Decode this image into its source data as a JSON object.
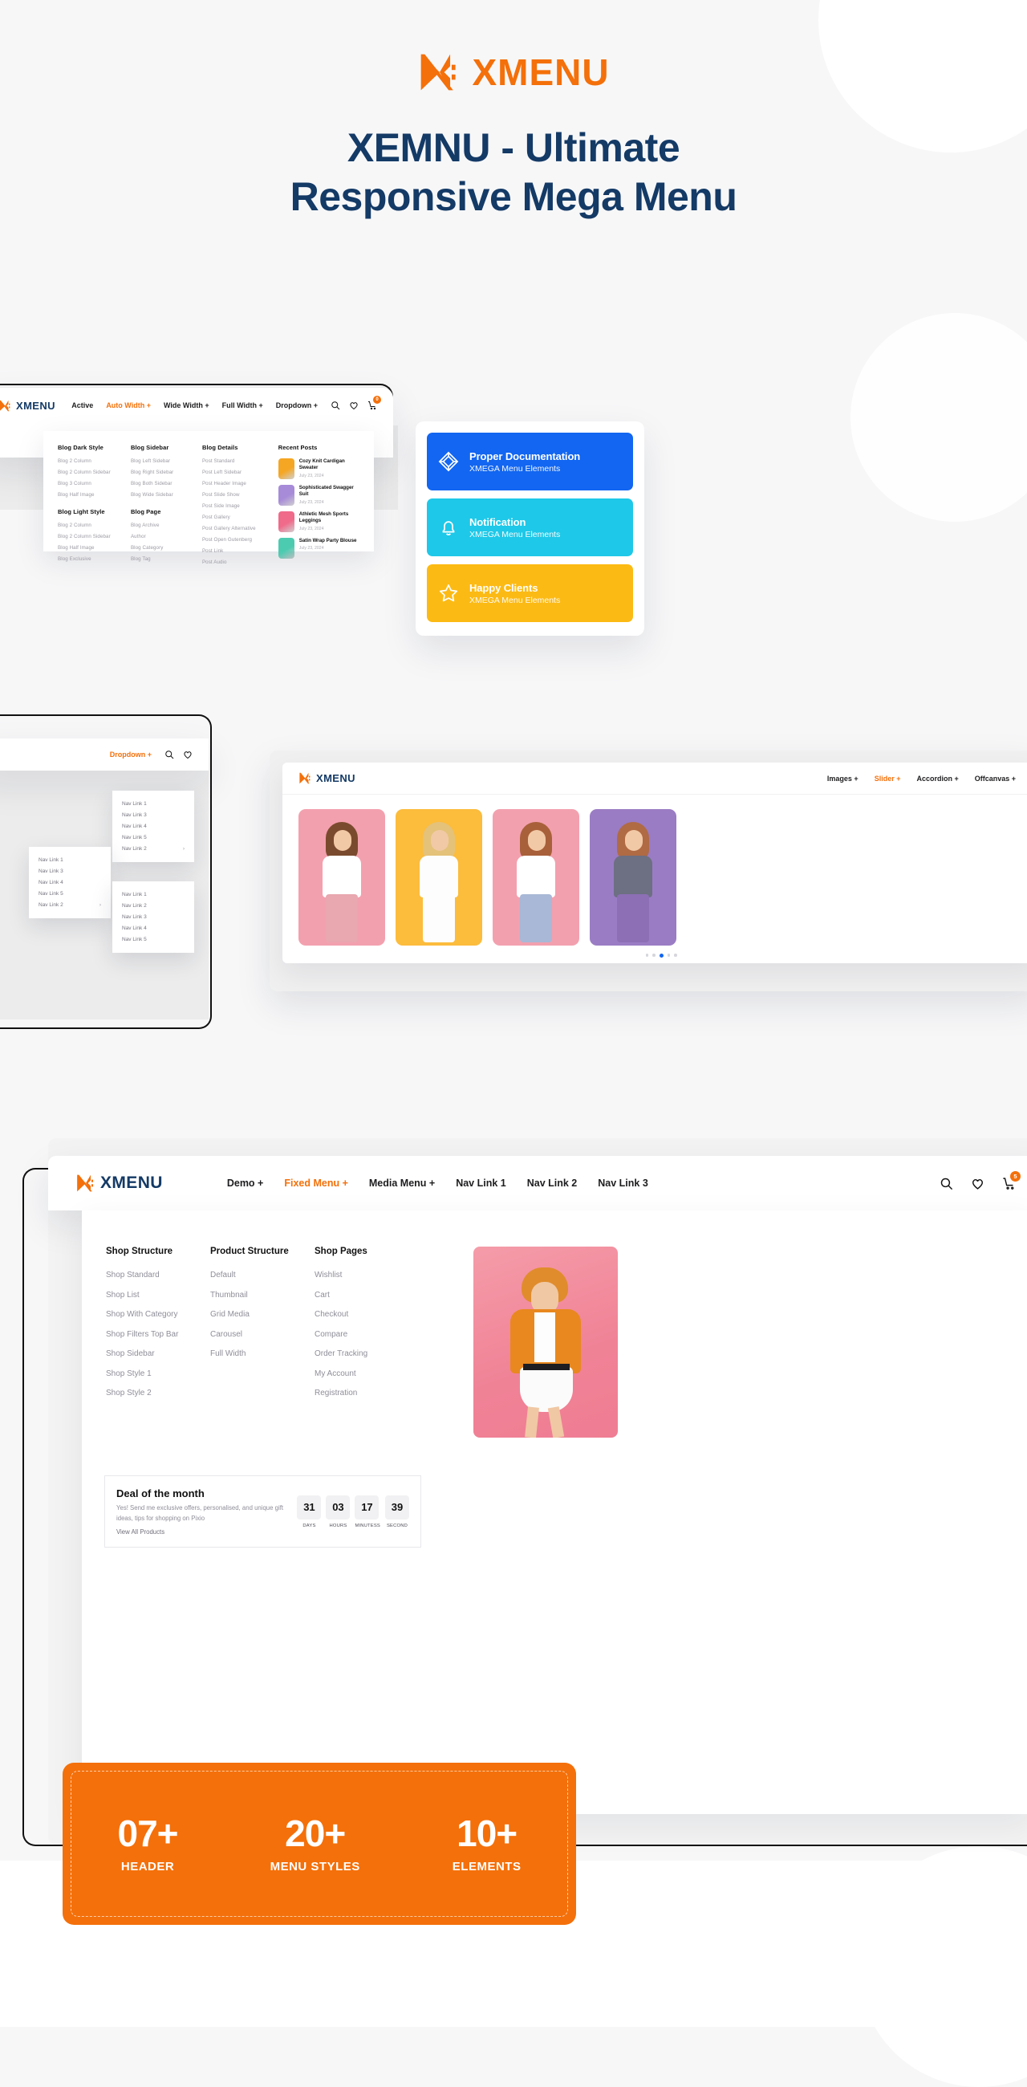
{
  "hero": {
    "logo_word": "XMENU",
    "title_line1": "XEMNU - Ultimate",
    "title_line2": "Responsive Mega Menu"
  },
  "blog_panel": {
    "brand": "XMENU",
    "nav": [
      {
        "label": "Active",
        "active": false,
        "plus": false
      },
      {
        "label": "Auto Width",
        "active": true,
        "plus": true
      },
      {
        "label": "Wide Width",
        "active": false,
        "plus": true
      },
      {
        "label": "Full Width",
        "active": false,
        "plus": true
      },
      {
        "label": "Dropdown",
        "active": false,
        "plus": true
      }
    ],
    "cart_badge": "0",
    "col1": {
      "heading1": "Blog Dark Style",
      "items1": [
        "Blog 2 Column",
        "Blog 2 Column Sidebar",
        "Blog 3 Column",
        "Blog Half Image"
      ],
      "heading2": "Blog Light Style",
      "items2": [
        "Blog 2 Column",
        "Blog 2 Column Sidebar",
        "Blog Half Image",
        "Blog Exclusive"
      ]
    },
    "col2": {
      "heading1": "Blog Sidebar",
      "items1": [
        "Blog Left Sidebar",
        "Blog Right Sidebar",
        "Blog Both Sidebar",
        "Blog Wide Sidebar"
      ],
      "heading2": "Blog Page",
      "items2": [
        "Blog Archive",
        "Author",
        "Blog Category",
        "Blog Tag"
      ]
    },
    "col3": {
      "heading": "Blog Details",
      "items": [
        "Post Standard",
        "Post Left Sidebar",
        "Post Header Image",
        "Post Slide Show",
        "Post Side Image",
        "Post Gallery",
        "Post Gallery Alternative",
        "Post Open Gutenberg",
        "Post Link",
        "Post Audio"
      ]
    },
    "col4": {
      "heading": "Recent Posts",
      "posts": [
        {
          "title": "Cozy Knit Cardigan Sweater",
          "date": "July 23, 2024",
          "thumb": "#f5a623"
        },
        {
          "title": "Sophisticated Swagger Suit",
          "date": "July 23, 2024",
          "thumb": "#a78bd8"
        },
        {
          "title": "Athletic Mesh Sports Leggings",
          "date": "July 23, 2024",
          "thumb": "#f06a8a"
        },
        {
          "title": "Satin Wrap Party Blouse",
          "date": "July 23, 2024",
          "thumb": "#4dcbb1"
        }
      ]
    }
  },
  "feature_cards": [
    {
      "title": "Proper Documentation",
      "subtitle": "XMEGA Menu Elements",
      "color": "#1266f1",
      "icon": "cube-icon"
    },
    {
      "title": "Notification",
      "subtitle": "XMEGA Menu Elements",
      "color": "#1ec8e8",
      "icon": "bell-icon"
    },
    {
      "title": "Happy Clients",
      "subtitle": "XMEGA Menu Elements",
      "color": "#fcba14",
      "icon": "star-icon"
    }
  ],
  "dropdown_demo": {
    "nav_label": "Dropdown",
    "menu1": [
      "Nav Link 1",
      "Nav Link 3",
      "Nav Link 4",
      "Nav Link 5",
      "Nav Link 2"
    ],
    "menu2": [
      "Nav Link 1",
      "Nav Link 3",
      "Nav Link 4",
      "Nav Link 5",
      "Nav Link 2"
    ],
    "menu3": [
      "Nav Link 1",
      "Nav Link 2",
      "Nav Link 3",
      "Nav Link 4",
      "Nav Link 5"
    ]
  },
  "slider_demo": {
    "brand": "XMENU",
    "nav": [
      {
        "label": "Images",
        "active": false,
        "plus": true
      },
      {
        "label": "Slider",
        "active": true,
        "plus": true
      },
      {
        "label": "Accordion",
        "active": false,
        "plus": true
      },
      {
        "label": "Offcanvas",
        "active": false,
        "plus": true
      }
    ],
    "slides": [
      {
        "bg": "#f3a0ae",
        "hair": "#7a4a2e",
        "top": "#ffffff",
        "bottom": "#e9a7b0"
      },
      {
        "bg": "#fcbc3c",
        "hair": "#e4c27a",
        "top": "#fdfdfd",
        "bottom": "#fdfdfd"
      },
      {
        "bg": "#f3a0ae",
        "hair": "#a8603a",
        "top": "#ffffff",
        "bottom": "#a8b8d6"
      },
      {
        "bg": "#9a7cc4",
        "hair": "#b06a44",
        "top": "#6d6f82",
        "bottom": "#8c6fb5"
      }
    ],
    "dots": 5,
    "active_dot": 2
  },
  "shop_panel": {
    "brand": "XMENU",
    "nav": [
      {
        "label": "Demo",
        "active": false,
        "plus": true
      },
      {
        "label": "Fixed Menu",
        "active": true,
        "plus": true
      },
      {
        "label": "Media Menu",
        "active": false,
        "plus": true
      },
      {
        "label": "Nav Link 1",
        "active": false,
        "plus": false
      },
      {
        "label": "Nav Link 2",
        "active": false,
        "plus": false
      },
      {
        "label": "Nav Link 3",
        "active": false,
        "plus": false
      }
    ],
    "cart_badge": "5",
    "col1": {
      "heading": "Shop Structure",
      "items": [
        "Shop Standard",
        "Shop List",
        "Shop With Category",
        "Shop Filters Top Bar",
        "Shop Sidebar",
        "Shop Style 1",
        "Shop Style 2"
      ]
    },
    "col2": {
      "heading": "Product Structure",
      "items": [
        "Default",
        "Thumbnail",
        "Grid Media",
        "Carousel",
        "Full Width"
      ]
    },
    "col3": {
      "heading": "Shop Pages",
      "items": [
        "Wishlist",
        "Cart",
        "Checkout",
        "Compare",
        "Order Tracking",
        "My Account",
        "Registration"
      ]
    },
    "deal": {
      "title": "Deal of the month",
      "paragraph": "Yes! Send me exclusive offers, personalised, and unique gift ideas, tips for shopping on Pixio",
      "action": "View All Products",
      "countdown": [
        {
          "value": "31",
          "label": "DAYS"
        },
        {
          "value": "03",
          "label": "HOURS"
        },
        {
          "value": "17",
          "label": "MINUTESS"
        },
        {
          "value": "39",
          "label": "SECOND"
        }
      ]
    }
  },
  "stats": [
    {
      "number": "07+",
      "label": "HEADER"
    },
    {
      "number": "20+",
      "label": "MENU STYLES"
    },
    {
      "number": "10+",
      "label": "ELEMENTS"
    }
  ],
  "colors": {
    "brand_orange": "#f4700a",
    "brand_navy": "#143a66",
    "muted": "#9b9ba4"
  }
}
